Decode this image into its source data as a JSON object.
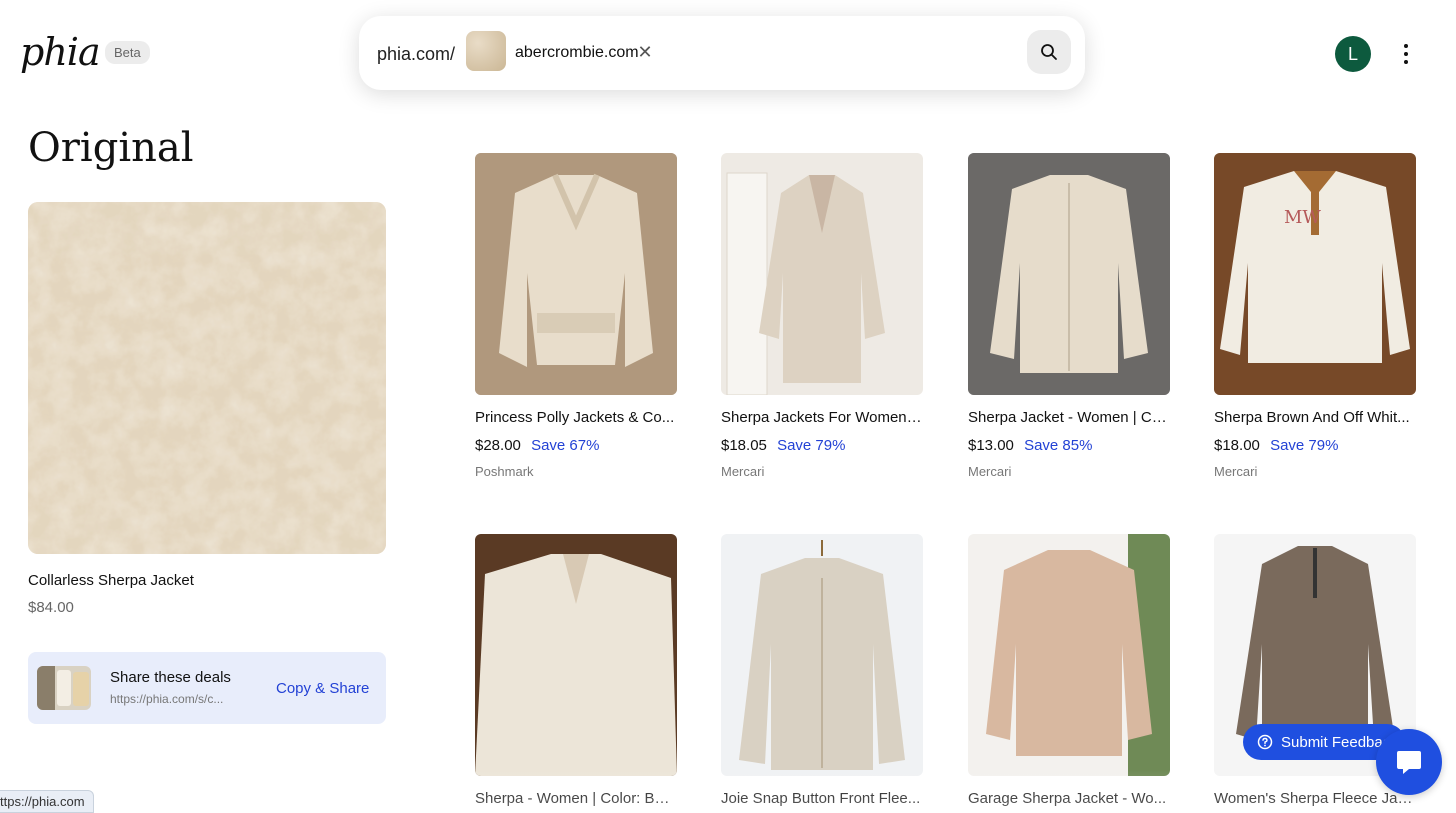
{
  "header": {
    "logo": "phia",
    "badge": "Beta",
    "search_prefix": "phia.com/",
    "search_chip": "abercrombie.com",
    "avatar_initial": "L"
  },
  "original": {
    "heading": "Original",
    "product_name": "Collarless Sherpa Jacket",
    "price": "$84.00"
  },
  "share": {
    "title": "Share these deals",
    "url": "https://phia.com/s/c...",
    "button_label": "Copy & Share"
  },
  "products": [
    {
      "title": "Princess Polly Jackets & Co...",
      "price": "$28.00",
      "save": "Save 67%",
      "source": "Poshmark"
    },
    {
      "title": "Sherpa Jackets For Women ...",
      "price": "$18.05",
      "save": "Save 79%",
      "source": "Mercari"
    },
    {
      "title": "Sherpa Jacket - Women | Co...",
      "price": "$13.00",
      "save": "Save 85%",
      "source": "Mercari"
    },
    {
      "title": "Sherpa Brown And Off Whit...",
      "price": "$18.00",
      "save": "Save 79%",
      "source": "Mercari"
    },
    {
      "title": "Sherpa - Women | Color: Bei...",
      "price": "",
      "save": "",
      "source": ""
    },
    {
      "title": "Joie Snap Button Front Flee...",
      "price": "",
      "save": "",
      "source": ""
    },
    {
      "title": "Garage Sherpa Jacket - Wo...",
      "price": "",
      "save": "",
      "source": ""
    },
    {
      "title": "Women's Sherpa Fleece Jac...",
      "price": "",
      "save": "",
      "source": ""
    }
  ],
  "feedback_label": "Submit Feedbac",
  "status_url": "ttps://phia.com",
  "colors": {
    "accent_blue": "#2342d5",
    "avatar_green": "#0d5a3e",
    "share_bg": "#e8edfb"
  }
}
